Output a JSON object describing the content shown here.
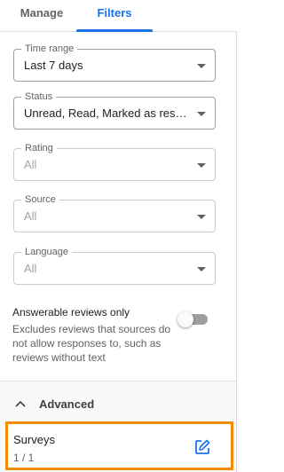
{
  "tabs": [
    {
      "label": "Manage",
      "active": false
    },
    {
      "label": "Filters",
      "active": true
    }
  ],
  "filters": [
    {
      "label": "Time range",
      "value": "Last 7 days",
      "disabled": false
    },
    {
      "label": "Status",
      "value": "Unread, Read, Marked as responded",
      "disabled": false
    },
    {
      "label": "Rating",
      "value": "All",
      "disabled": true
    },
    {
      "label": "Source",
      "value": "All",
      "disabled": true
    },
    {
      "label": "Language",
      "value": "All",
      "disabled": true
    }
  ],
  "answerable": {
    "title": "Answerable reviews only",
    "description": "Excludes reviews that sources do not allow responses to, such as reviews without text",
    "enabled": false
  },
  "advanced": {
    "label": "Advanced",
    "expanded": true,
    "icon": "chevron-up-icon"
  },
  "surveys": {
    "title": "Surveys",
    "count": "1 / 1",
    "icon": "edit-icon"
  },
  "colors": {
    "accent": "#1a73e8",
    "highlight": "#f28b00",
    "toggle_off": "#9e9e9e"
  }
}
